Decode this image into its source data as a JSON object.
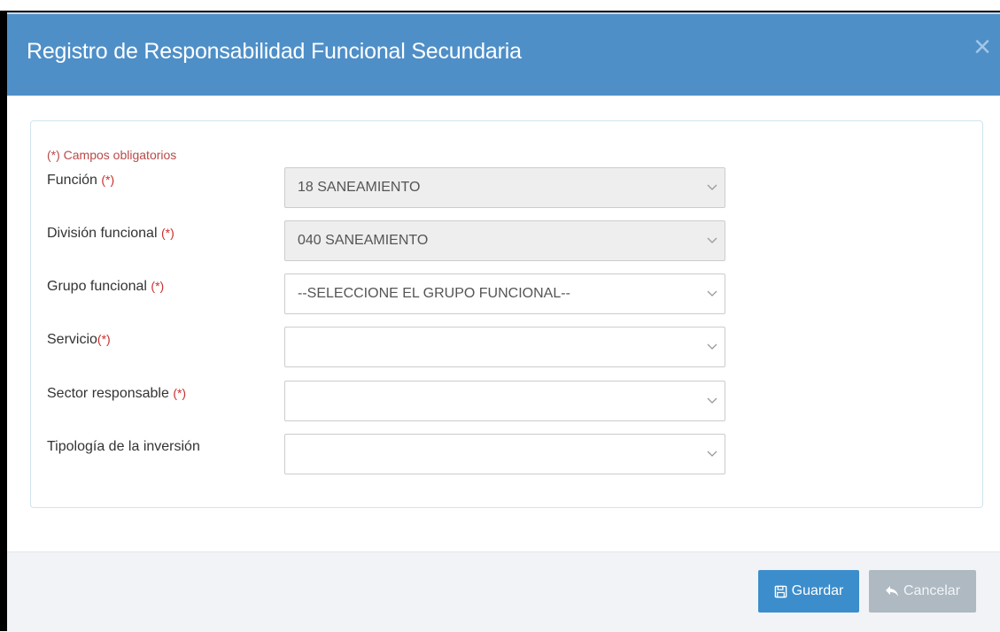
{
  "modal": {
    "title": "Registro de Responsabilidad Funcional Secundaria",
    "close_symbol": "×"
  },
  "form": {
    "required_note": "(*) Campos obligatorios",
    "required_mark": "(*)",
    "fields": [
      {
        "label": "Función",
        "required": true,
        "value": "18 SANEAMIENTO",
        "disabled": true
      },
      {
        "label": "División funcional",
        "required": true,
        "value": "040 SANEAMIENTO",
        "disabled": true
      },
      {
        "label": "Grupo funcional",
        "required": true,
        "value": "--SELECCIONE EL GRUPO FUNCIONAL--",
        "disabled": false
      },
      {
        "label": "Servicio",
        "required": true,
        "value": "",
        "disabled": false
      },
      {
        "label": "Sector responsable",
        "required": true,
        "value": "",
        "disabled": false
      },
      {
        "label": "Tipología de la inversión",
        "required": false,
        "value": "",
        "disabled": false
      }
    ]
  },
  "footer": {
    "save_label": "Guardar",
    "cancel_label": "Cancelar"
  },
  "icons": {
    "close": "close-icon",
    "chevron": "chevron-down-icon",
    "save": "floppy-disk-icon",
    "cancel": "reply-arrow-icon"
  },
  "colors": {
    "header": "#4e8fc8",
    "save_button": "#3c8dcb",
    "cancel_button": "#aeb9c2",
    "required": "#c9302c"
  }
}
